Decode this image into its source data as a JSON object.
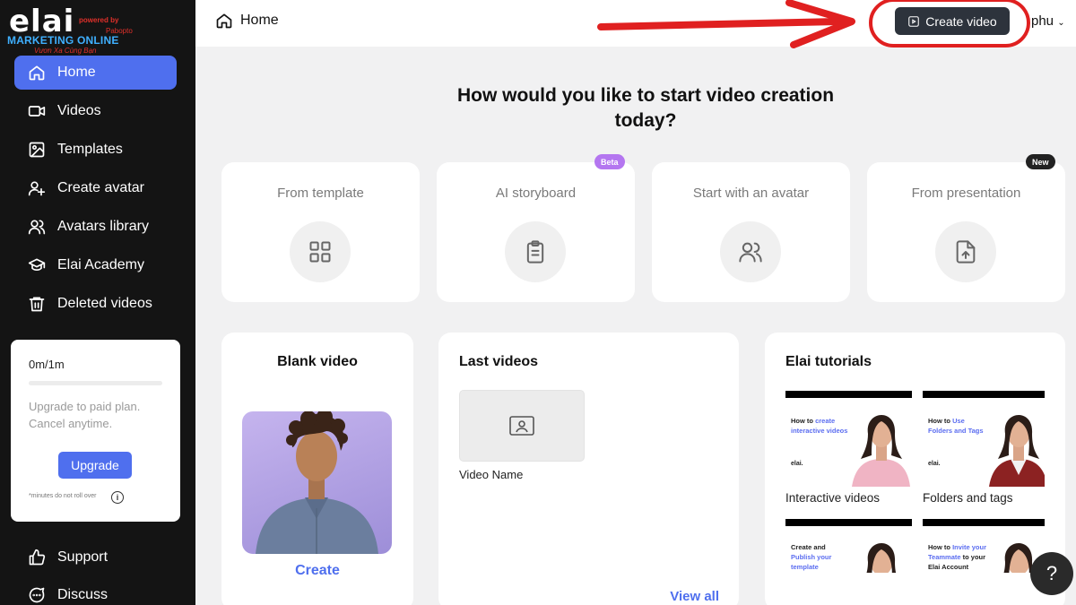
{
  "logo": {
    "main": "elai",
    "powered": "powered by",
    "powered_brand": "Pabopto",
    "marketing": "MARKETING ONLINE",
    "slogan": "Vươn Xa Cùng Bạn"
  },
  "sidebar": {
    "items": [
      {
        "label": "Home",
        "icon": "home-icon"
      },
      {
        "label": "Videos",
        "icon": "video-camera-icon"
      },
      {
        "label": "Templates",
        "icon": "templates-icon"
      },
      {
        "label": "Create avatar",
        "icon": "add-user-icon"
      },
      {
        "label": "Avatars library",
        "icon": "users-icon"
      },
      {
        "label": "Elai Academy",
        "icon": "graduation-cap-icon"
      },
      {
        "label": "Deleted videos",
        "icon": "trash-icon"
      }
    ],
    "bottom_items": [
      {
        "label": "Support",
        "icon": "thumbs-up-icon"
      },
      {
        "label": "Discuss",
        "icon": "chat-icon"
      }
    ]
  },
  "plan": {
    "usage": "0m/1m",
    "usage_fraction": 0,
    "text": "Upgrade to paid plan. Cancel anytime.",
    "upgrade_label": "Upgrade",
    "note": "*minutes do not roll over"
  },
  "header": {
    "breadcrumb": "Home",
    "create_video_label": "Create video",
    "user": "phu"
  },
  "main": {
    "heading": "How would you like to start video creation today?",
    "options": [
      {
        "title": "From template",
        "icon": "grid-icon",
        "badge": ""
      },
      {
        "title": "AI storyboard",
        "icon": "clipboard-icon",
        "badge": "Beta"
      },
      {
        "title": "Start with an avatar",
        "icon": "users-icon",
        "badge": ""
      },
      {
        "title": "From presentation",
        "icon": "file-upload-icon",
        "badge": "New"
      }
    ]
  },
  "blank_video": {
    "title": "Blank video",
    "create_label": "Create"
  },
  "last_videos": {
    "title": "Last videos",
    "video_name": "Video Name",
    "view_all": "View all"
  },
  "tutorials": {
    "title": "Elai tutorials",
    "items": [
      {
        "pre": "How to ",
        "highlight": "create interactive videos",
        "post": "",
        "brand": "elai.",
        "label": "Interactive videos"
      },
      {
        "pre": "How to ",
        "highlight": "Use Folders and Tags",
        "post": "",
        "brand": "elai.",
        "label": "Folders and tags"
      },
      {
        "pre": "Create and ",
        "highlight": "Publish your template",
        "post": "",
        "brand": "",
        "label": ""
      },
      {
        "pre": "How to ",
        "highlight": "Invite your Teammate",
        "post": " to your Elai Account",
        "brand": "",
        "label": ""
      }
    ]
  },
  "help": {
    "label": "?"
  },
  "colors": {
    "accent": "#4f6fee",
    "sidebar_bg": "#141414",
    "beta_badge": "#b476f0",
    "new_badge": "#222222",
    "annotation": "#e02020"
  }
}
